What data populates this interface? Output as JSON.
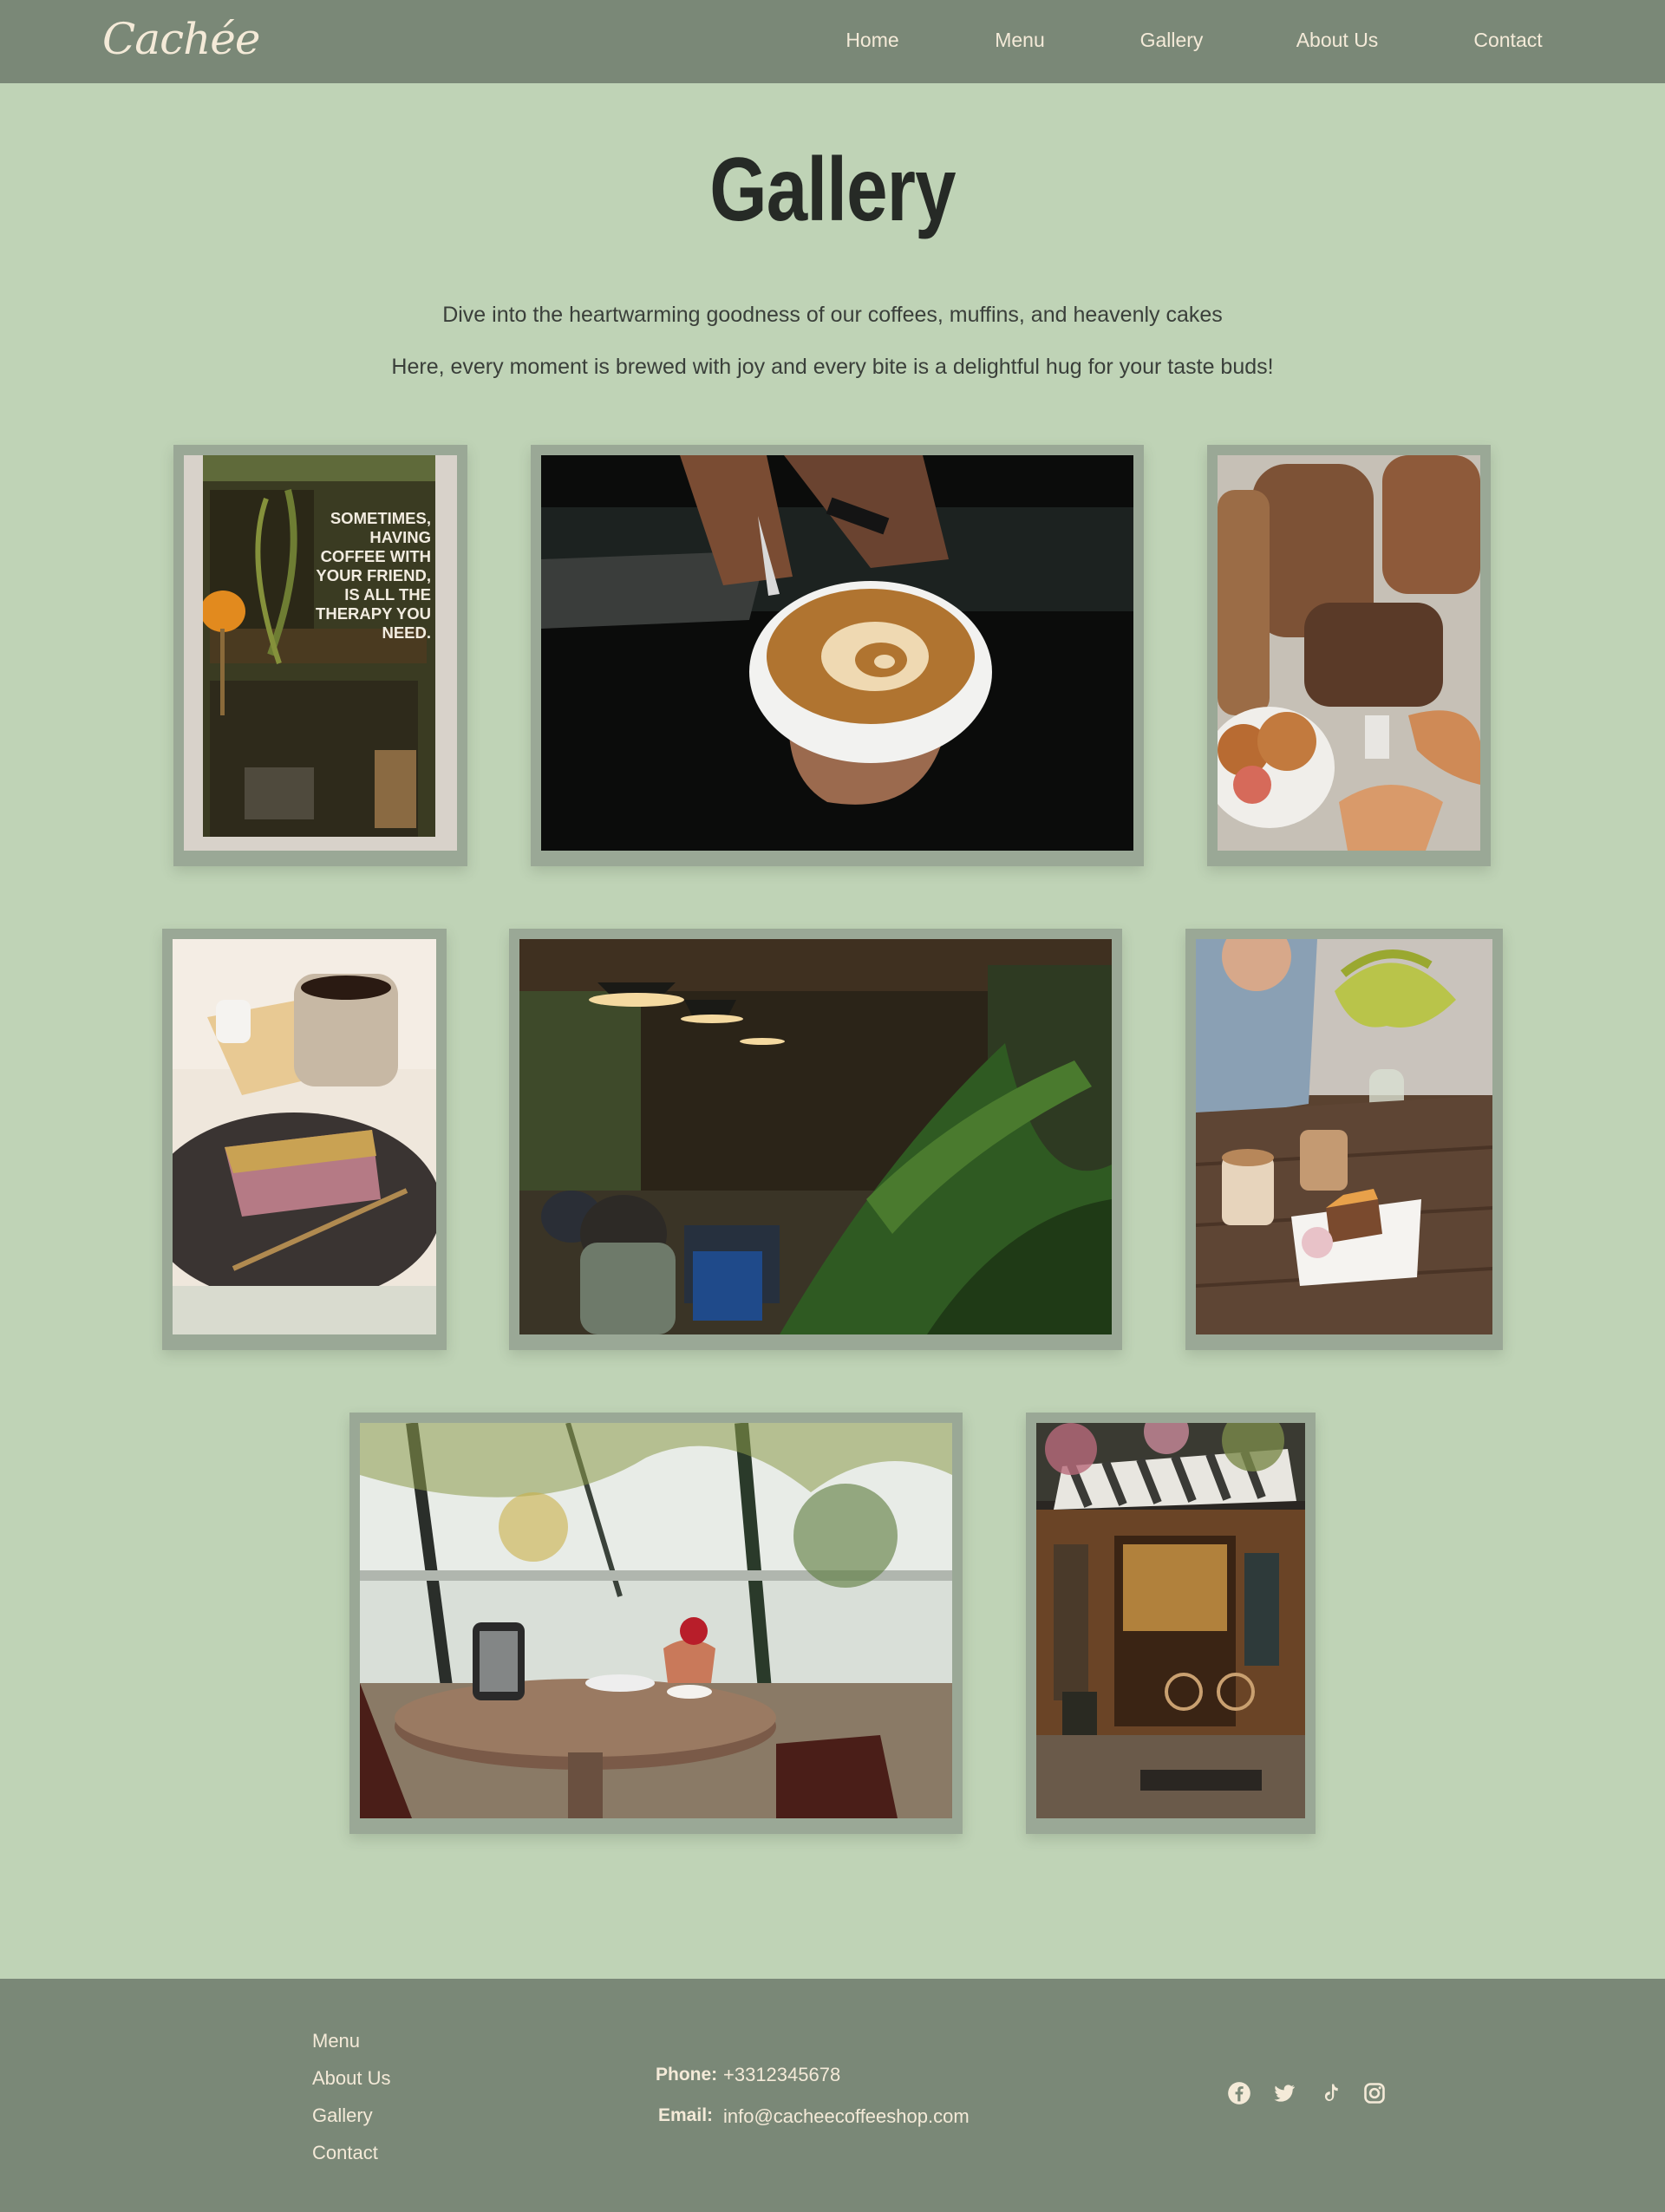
{
  "header": {
    "logo": "Cachée",
    "nav": [
      {
        "label": "Home"
      },
      {
        "label": "Menu"
      },
      {
        "label": "Gallery"
      },
      {
        "label": "About Us"
      },
      {
        "label": "Contact"
      }
    ]
  },
  "intro": {
    "title": "Gallery",
    "line1": "Dive into the heartwarming goodness of our coffees, muffins, and heavenly cakes",
    "line2": "Here, every moment is brewed with joy and every bite is a delightful hug for your taste buds!"
  },
  "gallery": {
    "quote_sign": "SOMETIMES,\nHAVING\nCOFFEE WITH\nYOUR FRIEND,\nIS ALL THE\nTHERAPY YOU\nNEED."
  },
  "footer": {
    "links": [
      {
        "label": "Menu"
      },
      {
        "label": "About Us"
      },
      {
        "label": "Gallery"
      },
      {
        "label": "Contact"
      }
    ],
    "phone_label": "Phone:",
    "phone": "+3312345678",
    "email_label": "Email:",
    "email": "info@cacheecoffeeshop.com",
    "social": [
      "facebook-icon",
      "twitter-icon",
      "tiktok-icon",
      "instagram-icon"
    ]
  },
  "colors": {
    "background": "#bfd3b6",
    "bar": "#7a8877",
    "frame": "#9aa896",
    "cream_text": "#f4ead8"
  }
}
